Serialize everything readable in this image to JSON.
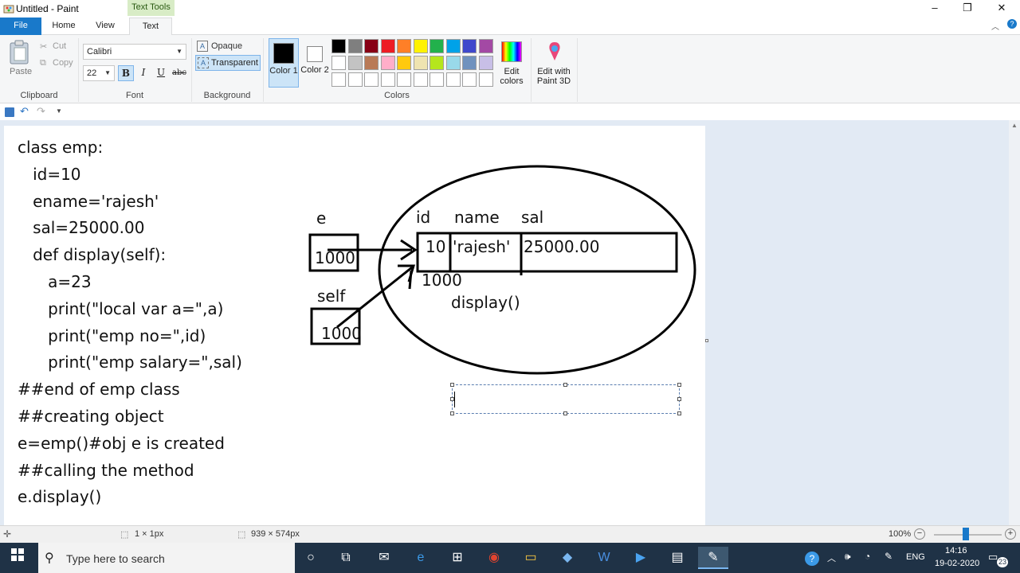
{
  "window": {
    "title": "Untitled - Paint",
    "context_tab": "Text Tools",
    "controls": {
      "minimize": "–",
      "maximize": "❐",
      "close": "✕"
    }
  },
  "tabs": [
    {
      "label": "File"
    },
    {
      "label": "Home"
    },
    {
      "label": "View"
    },
    {
      "label": "Text"
    }
  ],
  "ribbon": {
    "clipboard": {
      "paste": "Paste",
      "cut": "Cut",
      "copy": "Copy",
      "label": "Clipboard"
    },
    "font": {
      "family": "Calibri",
      "size": "22",
      "bold": "B",
      "italic": "I",
      "underline": "U",
      "strike": "abc",
      "label": "Font"
    },
    "background": {
      "opaque": "Opaque",
      "transparent": "Transparent",
      "label": "Background"
    },
    "colors": {
      "color1": "Color 1",
      "color2": "Color 2",
      "edit_colors": "Edit colors",
      "paint3d": "Edit with Paint 3D",
      "label": "Colors",
      "color1_value": "#000000",
      "color2_value": "#ffffff",
      "palette_row1": [
        "#000000",
        "#7f7f7f",
        "#880015",
        "#ed1c24",
        "#ff7f27",
        "#fff200",
        "#22b14c",
        "#00a2e8",
        "#3f48cc",
        "#a349a4"
      ],
      "palette_row2": [
        "#ffffff",
        "#c3c3c3",
        "#b97a57",
        "#ffaec9",
        "#ffc90e",
        "#efe4b0",
        "#b5e61d",
        "#99d9ea",
        "#7092be",
        "#c8bfe7"
      ],
      "palette_row3": [
        "#ffffff",
        "#ffffff",
        "#ffffff",
        "#ffffff",
        "#ffffff",
        "#ffffff",
        "#ffffff",
        "#ffffff",
        "#ffffff",
        "#ffffff"
      ]
    }
  },
  "canvas": {
    "code_lines": [
      "class emp:",
      "   id=10",
      "   ename='rajesh'",
      "   sal=25000.00",
      "   def display(self):",
      "      a=23",
      "      print(\"local var a=\",a)",
      "      print(\"emp no=\",id)",
      "      print(\"emp salary=\",sal)",
      "##end of emp class",
      "##creating object",
      "e=emp()#obj e is created",
      "##calling the method",
      "e.display()"
    ],
    "diagram": {
      "ref_e_label": "e",
      "ref_e_value": "1000",
      "ref_self_label": "self",
      "ref_self_value": "1000",
      "col_id": "id",
      "col_name": "name",
      "col_sal": "sal",
      "val_id": "10",
      "val_name": "'rajesh'",
      "val_sal": "25000.00",
      "object_address": "1000",
      "method": "display()"
    }
  },
  "statusbar": {
    "selection_size": "1 × 1px",
    "image_size": "939 × 574px",
    "zoom": "100%"
  },
  "taskbar": {
    "search_placeholder": "Type here to search",
    "language": "ENG",
    "time": "14:16",
    "date": "19-02-2020",
    "notifications": "23"
  }
}
